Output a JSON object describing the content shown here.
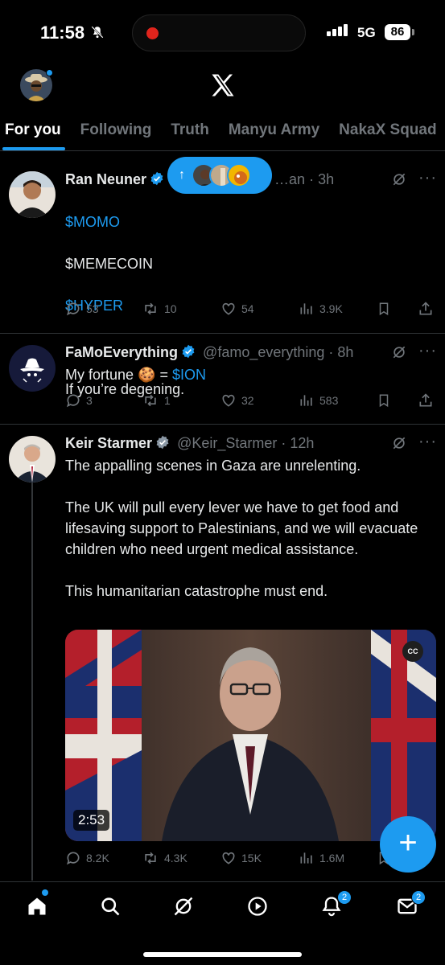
{
  "status_bar": {
    "time": "11:58",
    "network": "5G",
    "battery": "86"
  },
  "tabs": [
    "For you",
    "Following",
    "Truth",
    "Manyu Army",
    "NakaX Squad"
  ],
  "posts": [
    {
      "name": "Ran Neuner",
      "handle": "…an",
      "time": "3h",
      "lines": [
        {
          "text": "$MOMO",
          "type": "link"
        },
        {
          "text": "$MEMECOIN",
          "type": "text"
        },
        {
          "text": "$HYPER",
          "type": "link"
        },
        {
          "text": "",
          "type": "text"
        },
        {
          "text": "If you’re degening.",
          "type": "text"
        }
      ],
      "stats": {
        "replies": "53",
        "reposts": "10",
        "likes": "54",
        "views": "3.9K"
      }
    },
    {
      "name": "FaMoEverything",
      "handle": "@famo_everything",
      "time": "8h",
      "text_pre": "My fortune 🍪 = ",
      "text_link": "$ION",
      "stats": {
        "replies": "3",
        "reposts": "1",
        "likes": "32",
        "views": "583"
      }
    },
    {
      "name": "Keir Starmer",
      "handle": "@Keir_Starmer",
      "time": "12h",
      "text": "The appalling scenes in Gaza are unrelenting.\n\nThe UK will pull every lever we have to get food and lifesaving support to Palestinians, and we will evacuate children who need urgent medical assistance.\n\nThis humanitarian catastrophe must end.",
      "video": {
        "duration": "2:53",
        "cc_label": "CC"
      },
      "stats": {
        "replies": "8.2K",
        "reposts": "4.3K",
        "likes": "15K",
        "views": "1.6M"
      }
    }
  ],
  "new_posts_pill": {
    "arrow": "↑"
  },
  "fab": {
    "label": "+"
  },
  "bottom_nav": {
    "notifications_badge": "2",
    "messages_badge": "2"
  },
  "colors": {
    "accent": "#1d9bf0",
    "background": "#000000",
    "muted": "#71767b"
  }
}
